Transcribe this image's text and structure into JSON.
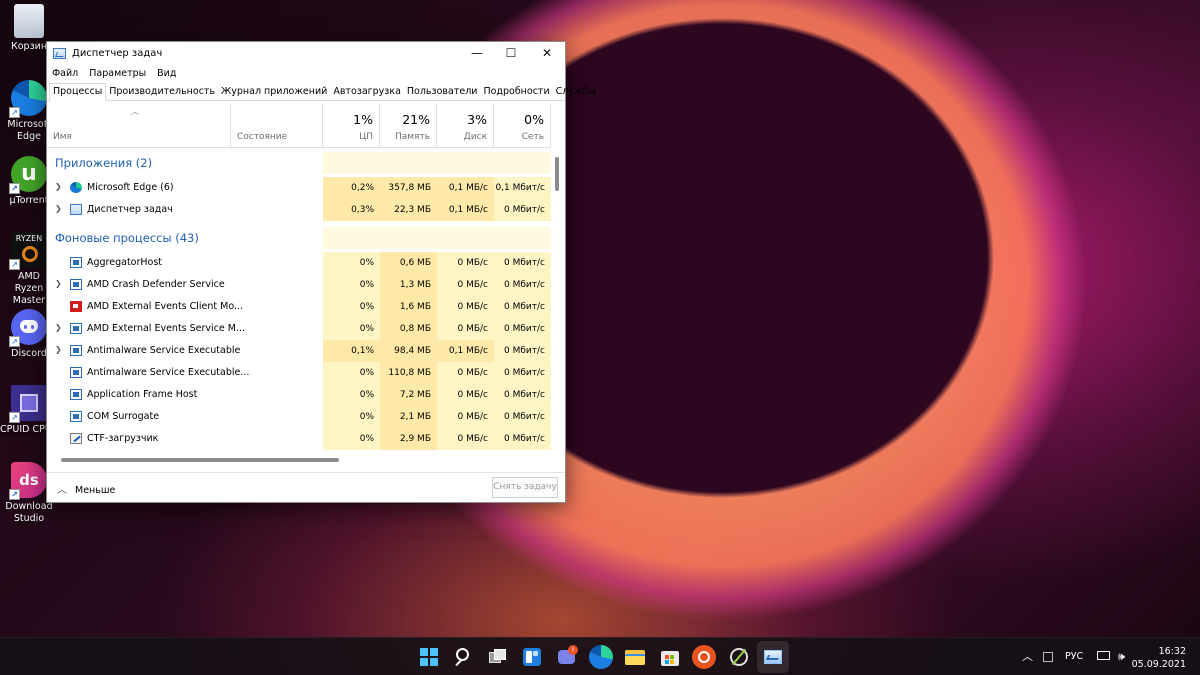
{
  "desktop": {
    "icons": [
      {
        "label": "Корзина"
      },
      {
        "label": "Microsoft Edge"
      },
      {
        "label": "µTorrent"
      },
      {
        "label": "AMD Ryzen Master"
      },
      {
        "label": "Discord"
      },
      {
        "label": "CPUID CPU-Z"
      },
      {
        "label": "Download Studio"
      }
    ]
  },
  "window": {
    "title": "Диспетчер задач",
    "controls": {
      "minimize": "—",
      "maximize": "☐",
      "close": "✕"
    },
    "menu": [
      "Файл",
      "Параметры",
      "Вид"
    ],
    "tabs": [
      "Процессы",
      "Производительность",
      "Журнал приложений",
      "Автозагрузка",
      "Пользователи",
      "Подробности",
      "Службы"
    ],
    "active_tab": "Процессы",
    "columns": {
      "name": "Имя",
      "status": "Состояние",
      "cpu": {
        "pct": "1%",
        "label": "ЦП"
      },
      "memory": {
        "pct": "21%",
        "label": "Память"
      },
      "disk": {
        "pct": "3%",
        "label": "Диск"
      },
      "network": {
        "pct": "0%",
        "label": "Сеть"
      }
    },
    "groups": {
      "apps": "Приложения (2)",
      "background": "Фоновые процессы (43)"
    },
    "apps": [
      {
        "name": "Microsoft Edge (6)",
        "cpu": "0,2%",
        "mem": "357,8 МБ",
        "disk": "0,1 МБ/с",
        "net": "0,1 Мбит/с",
        "icon": "edge-icon"
      },
      {
        "name": "Диспетчер задач",
        "cpu": "0,3%",
        "mem": "22,3 МБ",
        "disk": "0,1 МБ/с",
        "net": "0 Мбит/с",
        "icon": "task-manager-icon"
      }
    ],
    "background": [
      {
        "name": "AggregatorHost",
        "cpu": "0%",
        "mem": "0,6 МБ",
        "disk": "0 МБ/с",
        "net": "0 Мбит/с",
        "icon": "service-icon"
      },
      {
        "name": "AMD Crash Defender Service",
        "cpu": "0%",
        "mem": "1,3 МБ",
        "disk": "0 МБ/с",
        "net": "0 Мбит/с",
        "icon": "service-icon"
      },
      {
        "name": "AMD External Events Client Mo...",
        "cpu": "0%",
        "mem": "1,6 МБ",
        "disk": "0 МБ/с",
        "net": "0 Мбит/с",
        "icon": "amd-icon"
      },
      {
        "name": "AMD External Events Service M...",
        "cpu": "0%",
        "mem": "0,8 МБ",
        "disk": "0 МБ/с",
        "net": "0 Мбит/с",
        "icon": "service-icon"
      },
      {
        "name": "Antimalware Service Executable",
        "cpu": "0,1%",
        "mem": "98,4 МБ",
        "disk": "0,1 МБ/с",
        "net": "0 Мбит/с",
        "icon": "service-icon"
      },
      {
        "name": "Antimalware Service Executable...",
        "cpu": "0%",
        "mem": "110,8 МБ",
        "disk": "0 МБ/с",
        "net": "0 Мбит/с",
        "icon": "service-icon"
      },
      {
        "name": "Application Frame Host",
        "cpu": "0%",
        "mem": "7,2 МБ",
        "disk": "0 МБ/с",
        "net": "0 Мбит/с",
        "icon": "service-icon"
      },
      {
        "name": "COM Surrogate",
        "cpu": "0%",
        "mem": "2,1 МБ",
        "disk": "0 МБ/с",
        "net": "0 Мбит/с",
        "icon": "service-icon"
      },
      {
        "name": "CTF-загрузчик",
        "cpu": "0%",
        "mem": "2,9 МБ",
        "disk": "0 МБ/с",
        "net": "0 Мбит/с",
        "icon": "ctf-icon"
      }
    ],
    "footer": {
      "fewer": "Меньше",
      "end_task": "Снять задачу"
    }
  },
  "taskbar": {
    "language": "РУС",
    "time": "16:32",
    "date": "05.09.2021",
    "apps": [
      "start-icon",
      "search-icon",
      "task-view-icon",
      "widgets-icon",
      "teams-chat-icon",
      "edge-icon",
      "file-explorer-icon",
      "store-icon",
      "ubuntu-icon",
      "xbox-icon",
      "task-manager-icon"
    ]
  }
}
